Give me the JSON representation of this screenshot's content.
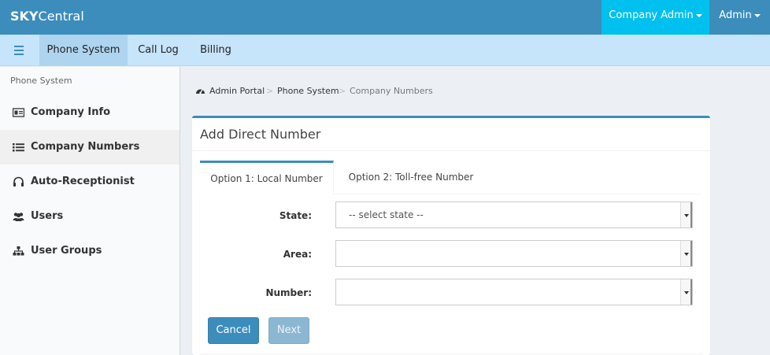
{
  "header": {
    "brand_bold": "SKY",
    "brand_rest": "Central",
    "company_menu": "Company Admin",
    "user_menu": "Admin"
  },
  "subnav": {
    "tabs": [
      {
        "label": "Phone System",
        "active": true
      },
      {
        "label": "Call Log",
        "active": false
      },
      {
        "label": "Billing",
        "active": false
      }
    ]
  },
  "sidebar": {
    "header": "Phone System",
    "items": [
      {
        "label": "Company Info",
        "icon": "id-card-icon",
        "active": false
      },
      {
        "label": "Company Numbers",
        "icon": "list-icon",
        "active": true
      },
      {
        "label": "Auto-Receptionist",
        "icon": "headset-icon",
        "active": false
      },
      {
        "label": "Users",
        "icon": "users-icon",
        "active": false
      },
      {
        "label": "User Groups",
        "icon": "sitemap-icon",
        "active": false
      }
    ]
  },
  "breadcrumb": {
    "items": [
      "Admin Portal",
      "Phone System",
      "Company Numbers"
    ],
    "separator": ">",
    "home_icon": "dashboard-icon"
  },
  "box": {
    "title": "Add Direct Number",
    "tabs": [
      {
        "label": "Option 1: Local Number",
        "active": true
      },
      {
        "label": "Option 2: Toll-free Number",
        "active": false
      }
    ],
    "form": {
      "state_label": "State:",
      "state_value": "-- select state --",
      "area_label": "Area:",
      "area_value": "",
      "number_label": "Number:",
      "number_value": ""
    },
    "cancel_label": "Cancel",
    "next_label": "Next"
  },
  "colors": {
    "primary": "#3c8dbc",
    "accent": "#00c0ef",
    "subnav": "#c6e4fa",
    "content_bg": "#ecf0f5"
  }
}
